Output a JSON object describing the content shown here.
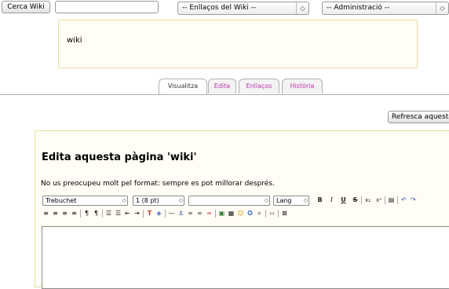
{
  "search": {
    "button_label": "Cerca Wiki",
    "input_value": ""
  },
  "selects": {
    "wiki_links": "-- Enllaços del Wiki --",
    "administration": "-- Administració --"
  },
  "page": {
    "wiki_name": "wiki"
  },
  "tabs": [
    {
      "label": "Visualitza"
    },
    {
      "label": "Edita"
    },
    {
      "label": "Enllaços"
    },
    {
      "label": "Història"
    }
  ],
  "refresh_button": {
    "label": "Refresca aquesta"
  },
  "editor": {
    "heading": "Edita aquesta pàgina 'wiki'",
    "hint": "No us preocupeu molt pel format: sempre es pot millorar després.",
    "font_family": "Trebuchet",
    "font_size": "1 (8 pt)",
    "style": "",
    "lang": "Lang",
    "content": ""
  },
  "colors": {
    "tab_link": "#bb33aa",
    "box_border": "#efdca0"
  }
}
